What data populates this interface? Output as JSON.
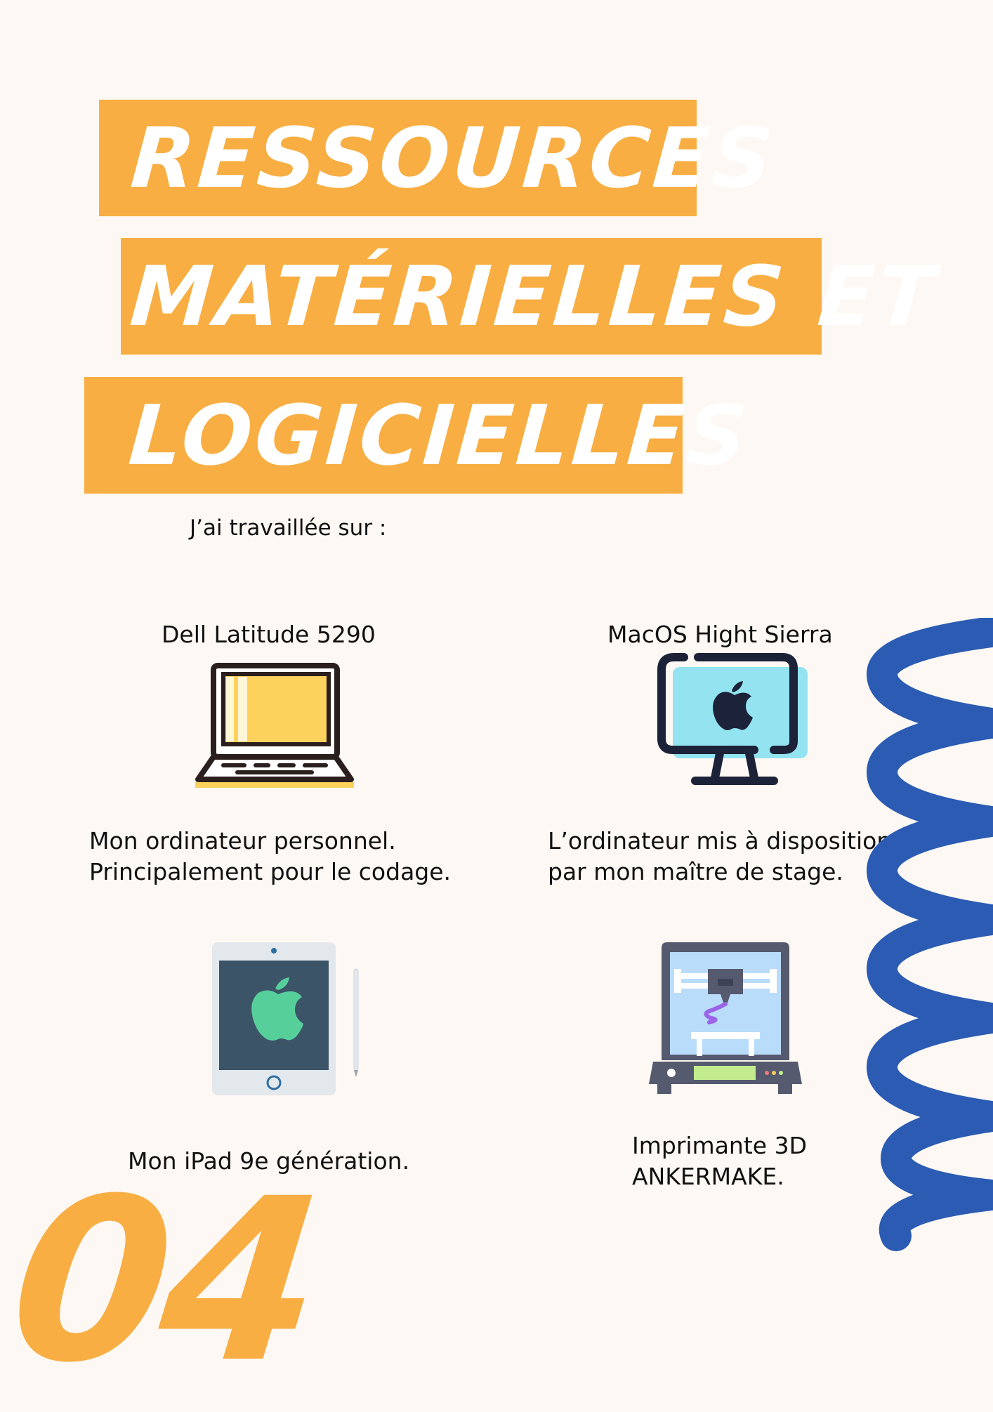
{
  "title": {
    "line1": "RESSOURCES",
    "line2": "MATÉRIELLES ET",
    "line3": "LOGICIELLES"
  },
  "intro": "J’ai travaillée sur :",
  "items": [
    {
      "label": "Dell Latitude 5290",
      "description_lines": [
        "Mon ordinateur personnel.",
        "Principalement pour le codage."
      ],
      "icon": "laptop-icon"
    },
    {
      "label": "MacOS Hight Sierra",
      "description_lines": [
        "L’ordinateur mis à disposition",
        "par mon maître de stage."
      ],
      "icon": "imac-icon"
    },
    {
      "label": "",
      "description_lines": [
        "Mon iPad 9e génération."
      ],
      "icon": "ipad-icon"
    },
    {
      "label": "",
      "description_lines": [
        "Imprimante 3D",
        "ANKERMAKE."
      ],
      "icon": "3d-printer-icon"
    }
  ],
  "page_number": "04",
  "colors": {
    "background": "#fdf8f3",
    "accent": "#f8ae42",
    "squiggle": "#2b5bb3"
  }
}
